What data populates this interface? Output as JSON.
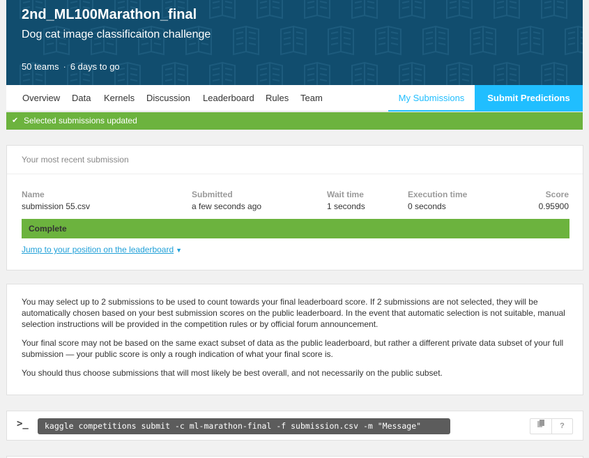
{
  "header": {
    "title": "2nd_ML100Marathon_final",
    "subtitle": "Dog cat image classificaiton challenge",
    "teams": "50 teams",
    "separator": "·",
    "deadline": "6 days to go",
    "background_color": "#114d6e",
    "pattern_icon": "book-icon"
  },
  "tabs": {
    "items": [
      "Overview",
      "Data",
      "Kernels",
      "Discussion",
      "Leaderboard",
      "Rules",
      "Team"
    ],
    "my_submissions": "My Submissions",
    "submit_predictions": "Submit Predictions",
    "accent_color": "#20beff"
  },
  "banner": {
    "text": "Selected submissions updated",
    "icon": "checkmark-icon",
    "color": "#6cb33e"
  },
  "recent_submission": {
    "heading": "Your most recent submission",
    "columns": {
      "name": "Name",
      "submitted": "Submitted",
      "wait_time": "Wait time",
      "execution_time": "Execution time",
      "score": "Score"
    },
    "row": {
      "name": "submission 55.csv",
      "submitted": "a few seconds ago",
      "wait_time": "1 seconds",
      "execution_time": "0 seconds",
      "score": "0.95900"
    },
    "status": "Complete",
    "jump_link": "Jump to your position on the leaderboard"
  },
  "info": {
    "paragraphs": [
      "You may select up to 2 submissions to be used to count towards your final leaderboard score. If 2 submissions are not selected, they will be automatically chosen based on your best submission scores on the public leaderboard. In the event that automatic selection is not suitable, manual selection instructions will be provided in the competition rules or by official forum announcement.",
      "Your final score may not be based on the same exact subset of data as the public leaderboard, but rather a different private data subset of your full submission — your public score is only a rough indication of what your final score is.",
      "You should thus choose submissions that will most likely be best overall, and not necessarily on the public subset."
    ]
  },
  "cli": {
    "prompt": ">_",
    "command": "kaggle competitions submit -c ml-marathon-final -f submission.csv -m \"Message\"",
    "copy_icon": "clipboard-icon",
    "help": "?"
  }
}
